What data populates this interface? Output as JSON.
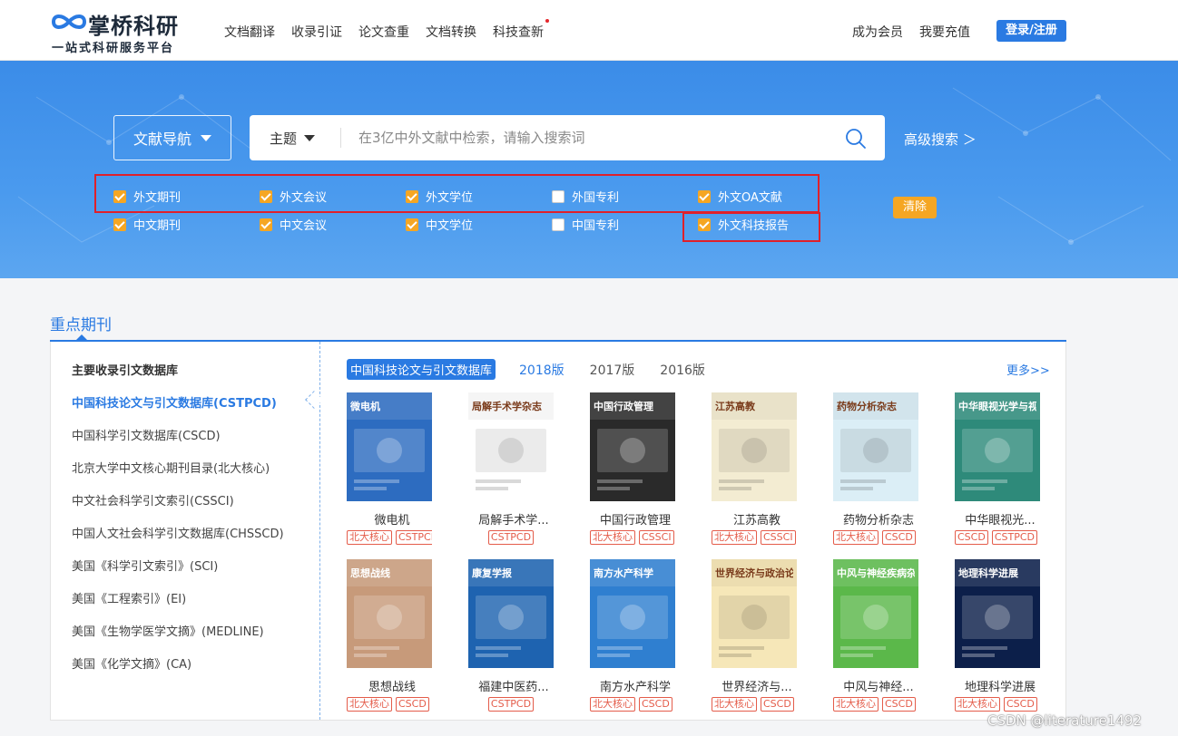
{
  "header": {
    "logo_title": "掌桥科研",
    "logo_slogan": "一站式科研服务平台",
    "nav": [
      "文档翻译",
      "收录引证",
      "论文查重",
      "文档转换",
      "科技查新"
    ],
    "become_member": "成为会员",
    "recharge": "我要充值",
    "login": "登录/注册"
  },
  "search": {
    "nav_dropdown": "文献导航",
    "field": "主题",
    "placeholder": "在3亿中外文献中检索，请输入搜索词",
    "advanced": "高级搜索 ＞",
    "clear": "清除"
  },
  "filters": {
    "row1": [
      {
        "label": "外文期刊",
        "checked": true
      },
      {
        "label": "外文会议",
        "checked": true
      },
      {
        "label": "外文学位",
        "checked": true
      },
      {
        "label": "外国专利",
        "checked": false
      },
      {
        "label": "外文OA文献",
        "checked": true
      }
    ],
    "row2": [
      {
        "label": "中文期刊",
        "checked": true
      },
      {
        "label": "中文会议",
        "checked": true
      },
      {
        "label": "中文学位",
        "checked": true
      },
      {
        "label": "中国专利",
        "checked": false
      },
      {
        "label": "外文科技报告",
        "checked": true
      }
    ]
  },
  "section": {
    "title": "重点期刊",
    "left_head": "主要收录引文数据库",
    "left_items": [
      "中国科技论文与引文数据库(CSTPCD)",
      "中国科学引文数据库(CSCD)",
      "北京大学中文核心期刊目录(北大核心)",
      "中文社会科学引文索引(CSSCI)",
      "中国人文社会科学引文数据库(CHSSCD)",
      "美国《科学引文索引》(SCI)",
      "美国《工程索引》(EI)",
      "美国《生物学医学文摘》(MEDLINE)",
      "美国《化学文摘》(CA)"
    ],
    "tabs": [
      "中国科技论文与引文数据库",
      "2018版",
      "2017版",
      "2016版"
    ],
    "more": "更多>>"
  },
  "journals": [
    {
      "name": "微电机",
      "cover_title": "微电机",
      "tags": [
        "北大核心",
        "CSTPCD"
      ],
      "bg": "#2d6cc0"
    },
    {
      "name": "局解手术学...",
      "cover_title": "局解手术学杂志",
      "tags": [
        "CSTPCD"
      ],
      "bg": "#ffffff"
    },
    {
      "name": "中国行政管理",
      "cover_title": "中国行政管理",
      "tags": [
        "北大核心",
        "CSSCI"
      ],
      "bg": "#2a2a2a"
    },
    {
      "name": "江苏高教",
      "cover_title": "江苏高教",
      "tags": [
        "北大核心",
        "CSSCI"
      ],
      "bg": "#f3ecd2"
    },
    {
      "name": "药物分析杂志",
      "cover_title": "药物分析杂志",
      "tags": [
        "北大核心",
        "CSCD"
      ],
      "bg": "#dbeef6"
    },
    {
      "name": "中华眼视光...",
      "cover_title": "中华眼视光学与视觉科学杂志",
      "tags": [
        "CSCD",
        "CSTPCD"
      ],
      "bg": "#2e8a7a"
    },
    {
      "name": "思想战线",
      "cover_title": "思想战线",
      "tags": [
        "北大核心",
        "CSCD"
      ],
      "bg": "#c79a7a"
    },
    {
      "name": "福建中医药...",
      "cover_title": "康复学报",
      "tags": [
        "CSTPCD"
      ],
      "bg": "#1e63b0"
    },
    {
      "name": "南方水产科学",
      "cover_title": "南方水产科学",
      "tags": [
        "北大核心",
        "CSCD"
      ],
      "bg": "#2f7fd0"
    },
    {
      "name": "世界经济与...",
      "cover_title": "世界经济与政治论坛",
      "tags": [
        "北大核心",
        "CSCD"
      ],
      "bg": "#f6e7b8"
    },
    {
      "name": "中风与神经...",
      "cover_title": "中风与神经疾病杂志",
      "tags": [
        "北大核心",
        "CSCD"
      ],
      "bg": "#5bb84a"
    },
    {
      "name": "地理科学进展",
      "cover_title": "地理科学进展",
      "tags": [
        "北大核心",
        "CSCD"
      ],
      "bg": "#0c1f4a"
    }
  ],
  "watermark": "CSDN @literature1492"
}
